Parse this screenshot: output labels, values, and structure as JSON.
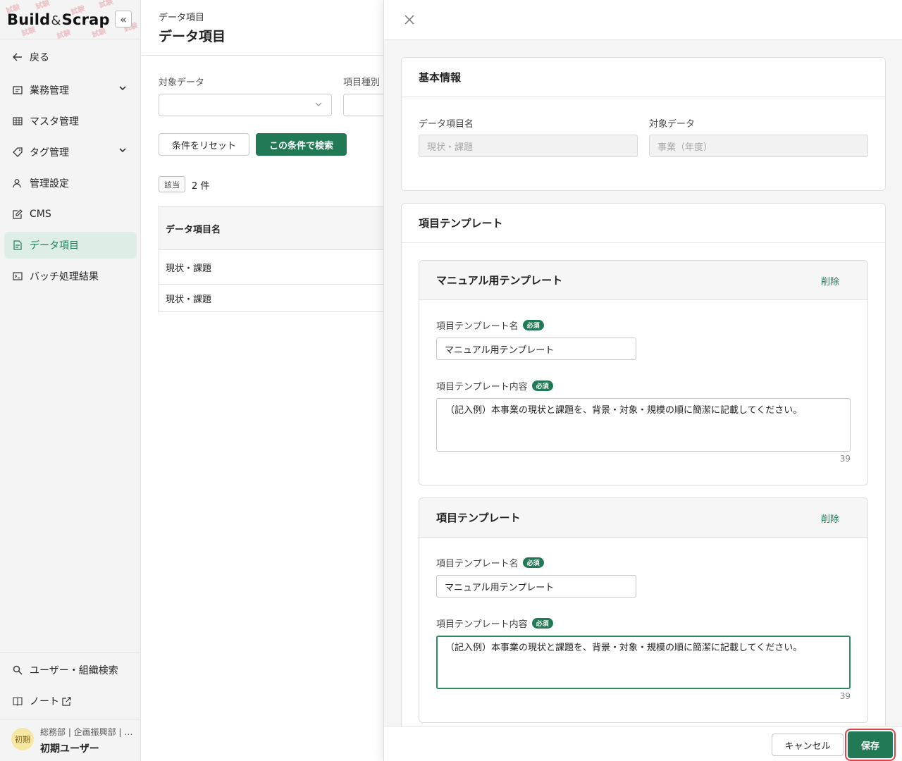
{
  "sidebar": {
    "logo_main": "Build",
    "logo_amp": "&",
    "logo_end": "Scrap",
    "collapse_icon": "«",
    "back_label": "戻る",
    "items": [
      {
        "label": "業務管理",
        "icon": "briefcase-icon",
        "expandable": true
      },
      {
        "label": "マスタ管理",
        "icon": "table-icon",
        "expandable": false
      },
      {
        "label": "タグ管理",
        "icon": "tag-icon",
        "expandable": true
      },
      {
        "label": "管理設定",
        "icon": "user-settings-icon",
        "expandable": false
      },
      {
        "label": "CMS",
        "icon": "edit-icon",
        "expandable": false
      },
      {
        "label": "データ項目",
        "icon": "data-item-icon",
        "expandable": false,
        "active": true
      },
      {
        "label": "バッチ処理結果",
        "icon": "terminal-icon",
        "expandable": false
      }
    ],
    "bottom_items": [
      {
        "label": "ユーザー・組織検索",
        "icon": "search-icon"
      },
      {
        "label": "ノート",
        "icon": "book-icon"
      }
    ],
    "user": {
      "avatar_text": "初期",
      "org": "総務部 | 企画振興部 | …",
      "name": "初期ユーザー"
    }
  },
  "main": {
    "breadcrumb": "データ項目",
    "title": "データ項目",
    "filter_target_label": "対象データ",
    "filter_type_label": "項目種別",
    "reset_button": "条件をリセット",
    "search_button": "この条件で検索",
    "count_badge": "該当",
    "count_text": "2 件",
    "table": {
      "header": "データ項目名",
      "rows": [
        "現状・課題",
        "現状・課題"
      ]
    }
  },
  "drawer": {
    "basic_info": {
      "title": "基本情報",
      "name_label": "データ項目名",
      "name_value": "現状・課題",
      "target_label": "対象データ",
      "target_value": "事業（年度）"
    },
    "templates_section_title": "項目テンプレート",
    "templates": [
      {
        "title": "マニュアル用テンプレート",
        "delete_label": "削除",
        "name_label": "項目テンプレート名",
        "required": "必須",
        "name_value": "マニュアル用テンプレート",
        "content_label": "項目テンプレート内容",
        "content_value": "（記入例）本事業の現状と課題を、背景・対象・規模の順に簡潔に記載してください。",
        "char_count": "39"
      },
      {
        "title": "項目テンプレート",
        "delete_label": "削除",
        "name_label": "項目テンプレート名",
        "required": "必須",
        "name_value": "マニュアル用テンプレート",
        "content_label": "項目テンプレート内容",
        "content_value": "（記入例）本事業の現状と課題を、背景・対象・規模の順に簡潔に記載してください。",
        "char_count": "39"
      }
    ],
    "cancel_button": "キャンセル",
    "save_button": "保存"
  },
  "colors": {
    "accent": "#217a55",
    "active_bg": "#deeee7",
    "highlight": "#d94848"
  }
}
